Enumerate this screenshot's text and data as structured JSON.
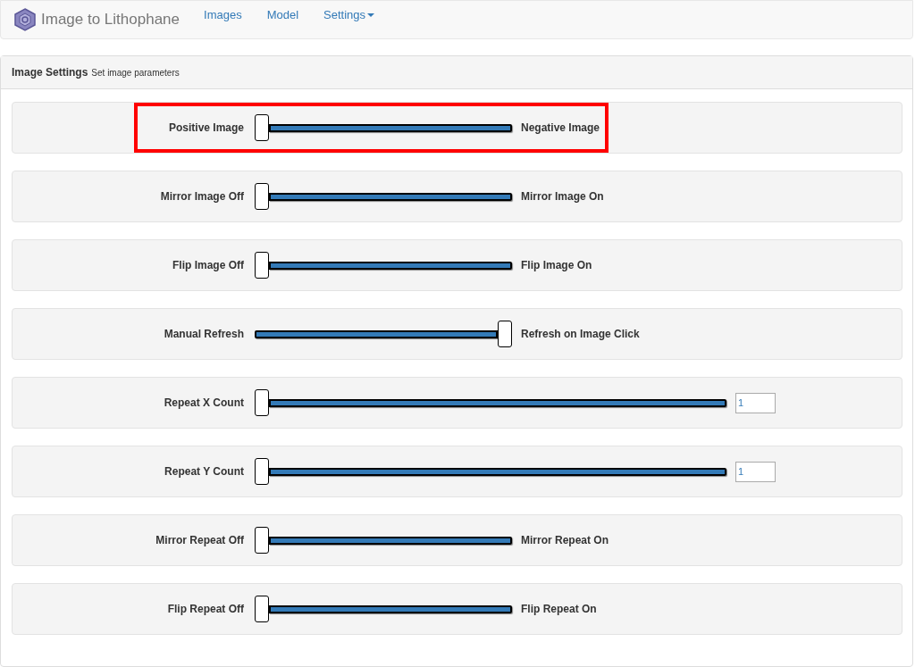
{
  "navbar": {
    "brand": "Image to Lithophane",
    "links": [
      {
        "label": "Images",
        "dropdown": false
      },
      {
        "label": "Model",
        "dropdown": false
      },
      {
        "label": "Settings",
        "dropdown": true
      }
    ]
  },
  "panel": {
    "title": "Image Settings",
    "subtitle": "Set image parameters",
    "rows": [
      {
        "kind": "toggle",
        "label": "Positive Image",
        "end_label": "Negative Image",
        "level": 0,
        "highlighted": true
      },
      {
        "kind": "toggle",
        "label": "Mirror Image Off",
        "end_label": "Mirror Image On",
        "level": 0,
        "highlighted": false
      },
      {
        "kind": "toggle",
        "label": "Flip Image Off",
        "end_label": "Flip Image On",
        "level": 0,
        "highlighted": false
      },
      {
        "kind": "toggle",
        "label": "Manual Refresh",
        "end_label": "Refresh on Image Click",
        "level": 1,
        "highlighted": false
      },
      {
        "kind": "count",
        "label": "Repeat X Count",
        "value": "1",
        "level": 0,
        "highlighted": false
      },
      {
        "kind": "count",
        "label": "Repeat Y Count",
        "value": "1",
        "level": 0,
        "highlighted": false
      },
      {
        "kind": "toggle",
        "label": "Mirror Repeat Off",
        "end_label": "Mirror Repeat On",
        "level": 0,
        "highlighted": false
      },
      {
        "kind": "toggle",
        "label": "Flip Repeat Off",
        "end_label": "Flip Repeat On",
        "level": 0,
        "highlighted": false
      }
    ]
  }
}
